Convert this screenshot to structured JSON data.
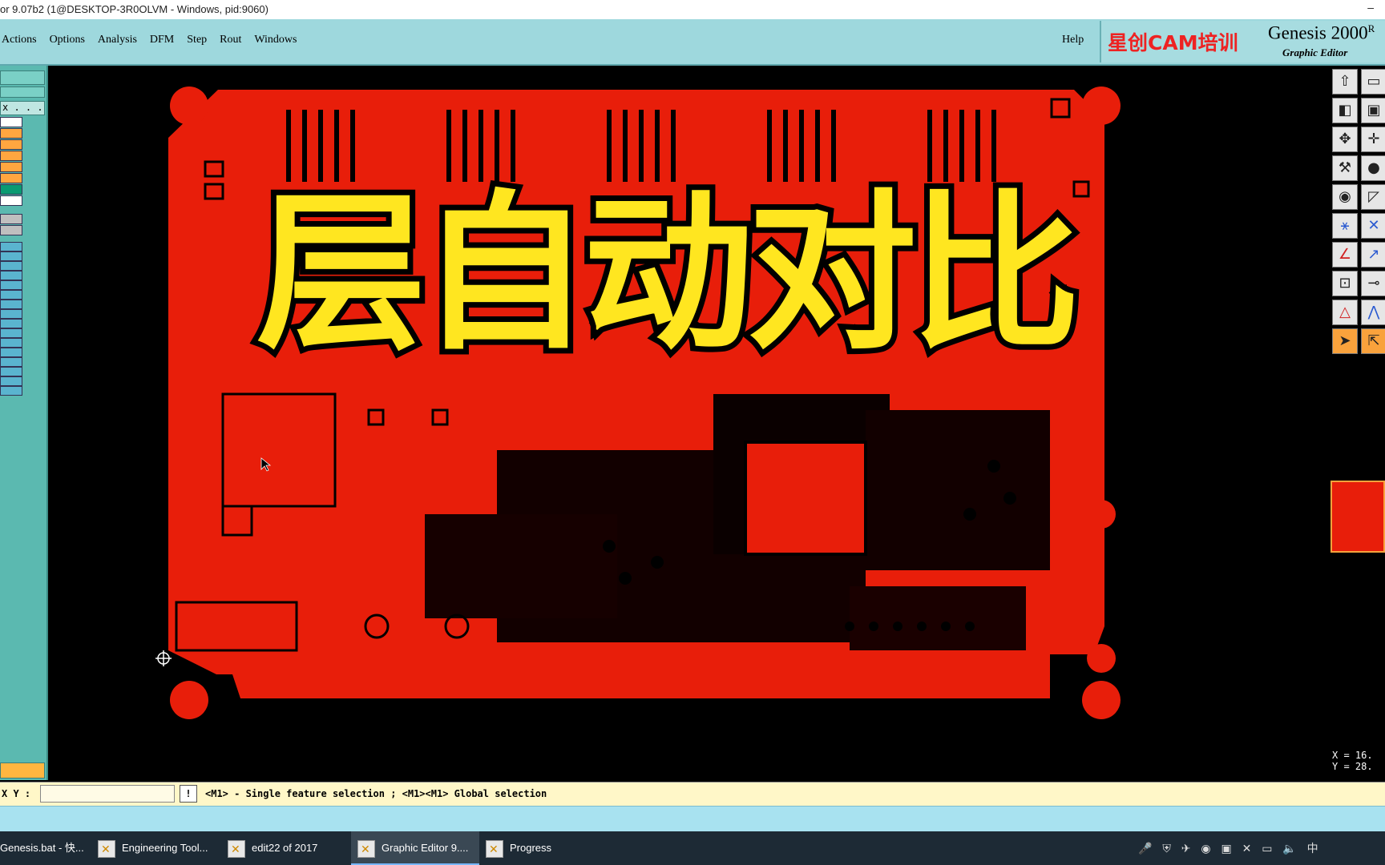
{
  "window": {
    "title": "or 9.07b2 (1@DESKTOP-3R0OLVM - Windows, pid:9060)"
  },
  "menubar": {
    "items": [
      "Actions",
      "Options",
      "Analysis",
      "DFM",
      "Step",
      "Rout",
      "Windows"
    ],
    "help": "Help"
  },
  "brand": {
    "cn": "星创CAM培训",
    "product": "Genesis 2000",
    "product_sup": "R",
    "subtitle": "Graphic Editor"
  },
  "left_panel": {
    "dots_label": "x . . ."
  },
  "canvas": {
    "overlay_text": "层自动对比",
    "board_color": "#e81e0a",
    "background_color": "#000000"
  },
  "right_panel": {
    "coord_x": "X = 16.",
    "coord_y": "Y = 28."
  },
  "command_line": {
    "xy_label": "X Y :",
    "xy_value": "",
    "bang": "!",
    "hint": "<M1> - Single feature selection ; <M1><M1> Global selection"
  },
  "taskbar": {
    "tasks": [
      {
        "label": "Genesis.bat - 快..."
      },
      {
        "label": "Engineering Tool..."
      },
      {
        "label": "edit22 of 2017"
      },
      {
        "label": "Graphic Editor 9...."
      },
      {
        "label": "Progress"
      }
    ],
    "tray_lang": "中"
  }
}
